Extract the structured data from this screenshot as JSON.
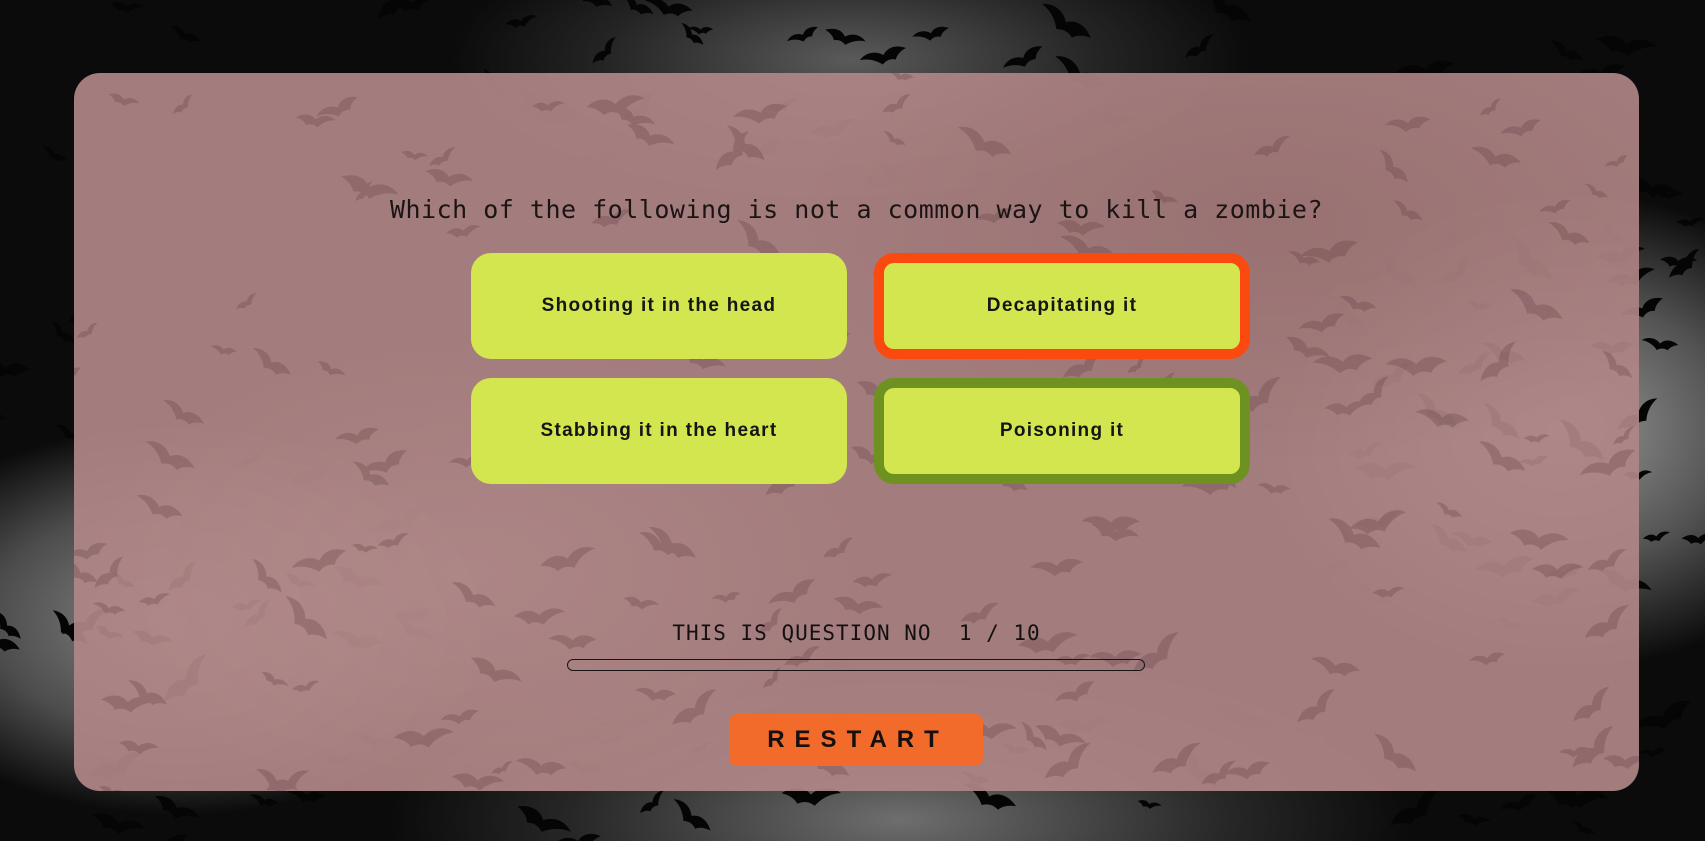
{
  "quiz": {
    "question": "Which of the following is not a common way to kill a zombie?",
    "answers": [
      {
        "label": "Shooting it in the head",
        "state": "default"
      },
      {
        "label": "Decapitating it",
        "state": "wrong-selected"
      },
      {
        "label": "Stabbing it in the heart",
        "state": "default"
      },
      {
        "label": "Poisoning it",
        "state": "correct"
      }
    ],
    "progress": {
      "text": "THIS IS QUESTION NO  1 / 10",
      "current": 1,
      "total": 10,
      "fraction": 0
    },
    "restart_label": "RESTART"
  },
  "colors": {
    "card": "#af8586",
    "answer_bg": "#d3e650",
    "wrong_border": "#fa4a10",
    "correct_border": "#6e9221",
    "restart_bg": "#f26b2a"
  },
  "background": {
    "description_icon": "flock-of-birds"
  }
}
